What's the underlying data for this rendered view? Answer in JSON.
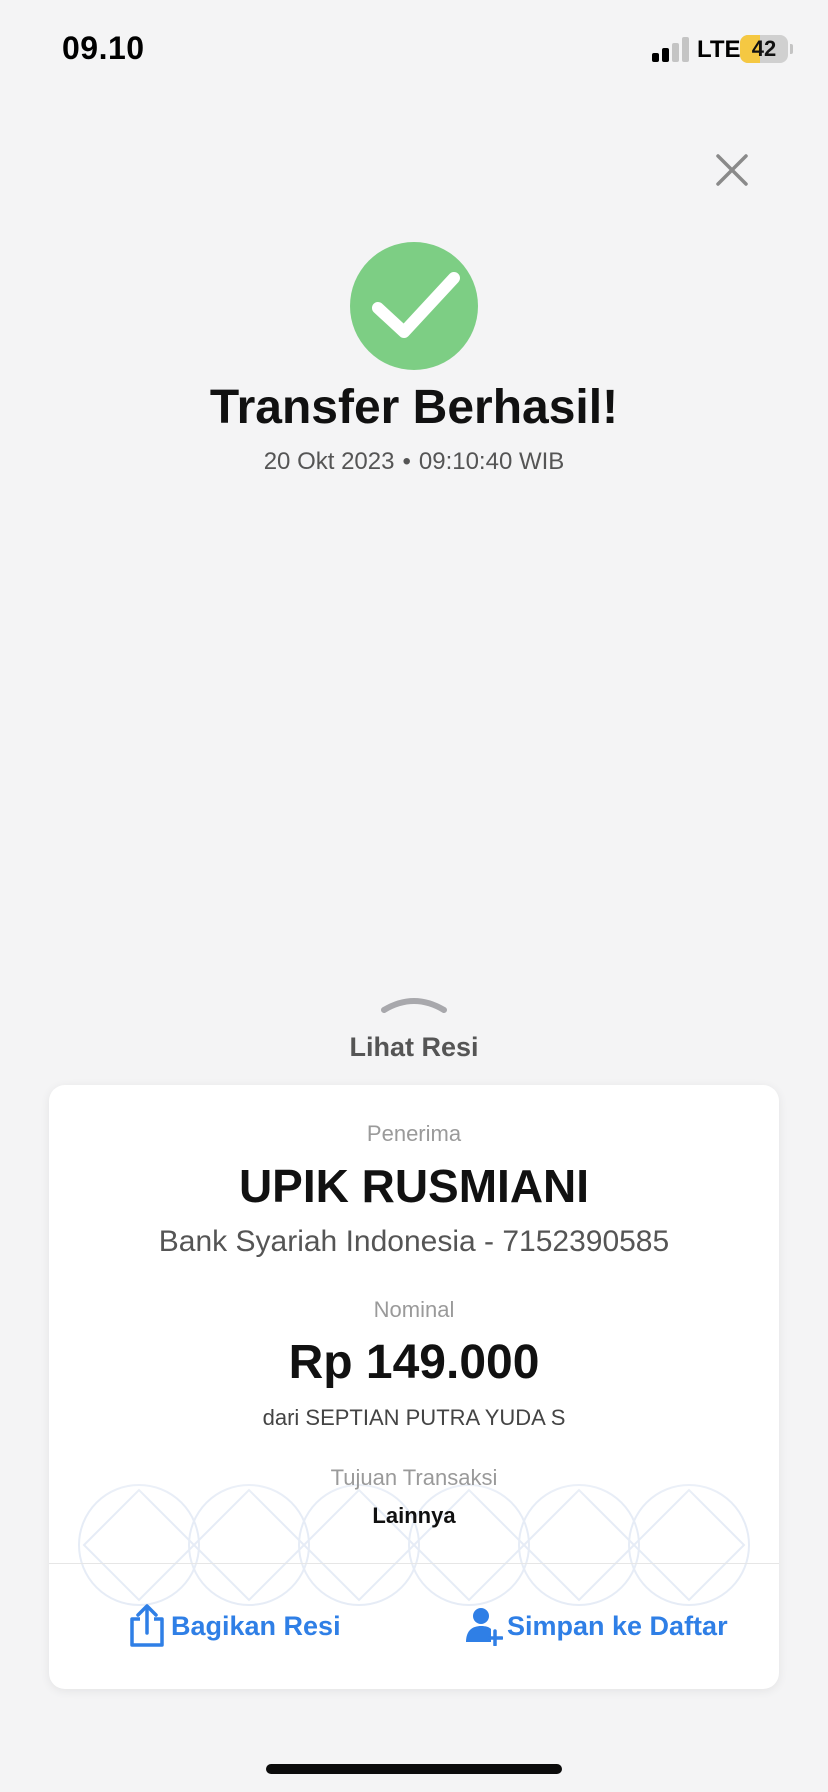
{
  "status_bar": {
    "time": "09.10",
    "network": "LTE",
    "battery_percent": "42",
    "battery_level": 0.42,
    "signal_bars_active": 2,
    "signal_bars_total": 4
  },
  "header": {
    "close_icon": "close-icon"
  },
  "success": {
    "icon": "check-circle-icon",
    "icon_color": "#7dce84",
    "title": "Transfer Berhasil!",
    "date": "20 Okt 2023",
    "separator": "•",
    "time": "09:10:40 WIB"
  },
  "receipt_toggle": {
    "icon": "chevron-up-icon",
    "label": "Lihat Resi"
  },
  "receipt": {
    "recipient_label": "Penerima",
    "recipient_name": "UPIK RUSMIANI",
    "bank_account": "Bank Syariah Indonesia - 7152390585",
    "amount_label": "Nominal",
    "amount": "Rp 149.000",
    "sender": "dari SEPTIAN PUTRA YUDA S",
    "purpose_label": "Tujuan Transaksi",
    "purpose": "Lainnya"
  },
  "actions": {
    "share_icon": "share-icon",
    "share_label": "Bagikan Resi",
    "save_icon": "add-person-icon",
    "save_label": "Simpan ke Daftar",
    "accent_color": "#2f7fe6"
  }
}
